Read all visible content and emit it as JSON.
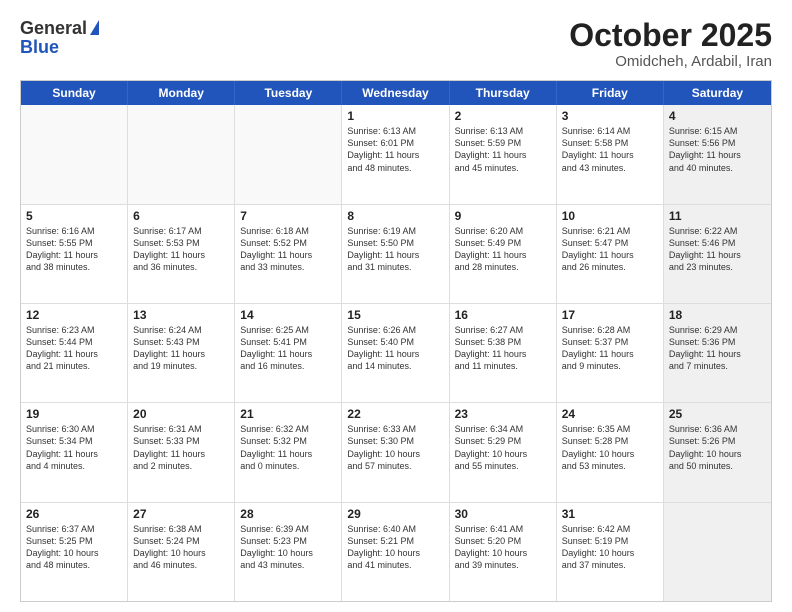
{
  "header": {
    "logo_general": "General",
    "logo_blue": "Blue",
    "month_title": "October 2025",
    "subtitle": "Omidcheh, Ardabil, Iran"
  },
  "weekdays": [
    "Sunday",
    "Monday",
    "Tuesday",
    "Wednesday",
    "Thursday",
    "Friday",
    "Saturday"
  ],
  "rows": [
    [
      {
        "day": "",
        "info": "",
        "empty": true
      },
      {
        "day": "",
        "info": "",
        "empty": true
      },
      {
        "day": "",
        "info": "",
        "empty": true
      },
      {
        "day": "1",
        "info": "Sunrise: 6:13 AM\nSunset: 6:01 PM\nDaylight: 11 hours\nand 48 minutes."
      },
      {
        "day": "2",
        "info": "Sunrise: 6:13 AM\nSunset: 5:59 PM\nDaylight: 11 hours\nand 45 minutes."
      },
      {
        "day": "3",
        "info": "Sunrise: 6:14 AM\nSunset: 5:58 PM\nDaylight: 11 hours\nand 43 minutes."
      },
      {
        "day": "4",
        "info": "Sunrise: 6:15 AM\nSunset: 5:56 PM\nDaylight: 11 hours\nand 40 minutes.",
        "shaded": true
      }
    ],
    [
      {
        "day": "5",
        "info": "Sunrise: 6:16 AM\nSunset: 5:55 PM\nDaylight: 11 hours\nand 38 minutes."
      },
      {
        "day": "6",
        "info": "Sunrise: 6:17 AM\nSunset: 5:53 PM\nDaylight: 11 hours\nand 36 minutes."
      },
      {
        "day": "7",
        "info": "Sunrise: 6:18 AM\nSunset: 5:52 PM\nDaylight: 11 hours\nand 33 minutes."
      },
      {
        "day": "8",
        "info": "Sunrise: 6:19 AM\nSunset: 5:50 PM\nDaylight: 11 hours\nand 31 minutes."
      },
      {
        "day": "9",
        "info": "Sunrise: 6:20 AM\nSunset: 5:49 PM\nDaylight: 11 hours\nand 28 minutes."
      },
      {
        "day": "10",
        "info": "Sunrise: 6:21 AM\nSunset: 5:47 PM\nDaylight: 11 hours\nand 26 minutes."
      },
      {
        "day": "11",
        "info": "Sunrise: 6:22 AM\nSunset: 5:46 PM\nDaylight: 11 hours\nand 23 minutes.",
        "shaded": true
      }
    ],
    [
      {
        "day": "12",
        "info": "Sunrise: 6:23 AM\nSunset: 5:44 PM\nDaylight: 11 hours\nand 21 minutes."
      },
      {
        "day": "13",
        "info": "Sunrise: 6:24 AM\nSunset: 5:43 PM\nDaylight: 11 hours\nand 19 minutes."
      },
      {
        "day": "14",
        "info": "Sunrise: 6:25 AM\nSunset: 5:41 PM\nDaylight: 11 hours\nand 16 minutes."
      },
      {
        "day": "15",
        "info": "Sunrise: 6:26 AM\nSunset: 5:40 PM\nDaylight: 11 hours\nand 14 minutes."
      },
      {
        "day": "16",
        "info": "Sunrise: 6:27 AM\nSunset: 5:38 PM\nDaylight: 11 hours\nand 11 minutes."
      },
      {
        "day": "17",
        "info": "Sunrise: 6:28 AM\nSunset: 5:37 PM\nDaylight: 11 hours\nand 9 minutes."
      },
      {
        "day": "18",
        "info": "Sunrise: 6:29 AM\nSunset: 5:36 PM\nDaylight: 11 hours\nand 7 minutes.",
        "shaded": true
      }
    ],
    [
      {
        "day": "19",
        "info": "Sunrise: 6:30 AM\nSunset: 5:34 PM\nDaylight: 11 hours\nand 4 minutes."
      },
      {
        "day": "20",
        "info": "Sunrise: 6:31 AM\nSunset: 5:33 PM\nDaylight: 11 hours\nand 2 minutes."
      },
      {
        "day": "21",
        "info": "Sunrise: 6:32 AM\nSunset: 5:32 PM\nDaylight: 11 hours\nand 0 minutes."
      },
      {
        "day": "22",
        "info": "Sunrise: 6:33 AM\nSunset: 5:30 PM\nDaylight: 10 hours\nand 57 minutes."
      },
      {
        "day": "23",
        "info": "Sunrise: 6:34 AM\nSunset: 5:29 PM\nDaylight: 10 hours\nand 55 minutes."
      },
      {
        "day": "24",
        "info": "Sunrise: 6:35 AM\nSunset: 5:28 PM\nDaylight: 10 hours\nand 53 minutes."
      },
      {
        "day": "25",
        "info": "Sunrise: 6:36 AM\nSunset: 5:26 PM\nDaylight: 10 hours\nand 50 minutes.",
        "shaded": true
      }
    ],
    [
      {
        "day": "26",
        "info": "Sunrise: 6:37 AM\nSunset: 5:25 PM\nDaylight: 10 hours\nand 48 minutes."
      },
      {
        "day": "27",
        "info": "Sunrise: 6:38 AM\nSunset: 5:24 PM\nDaylight: 10 hours\nand 46 minutes."
      },
      {
        "day": "28",
        "info": "Sunrise: 6:39 AM\nSunset: 5:23 PM\nDaylight: 10 hours\nand 43 minutes."
      },
      {
        "day": "29",
        "info": "Sunrise: 6:40 AM\nSunset: 5:21 PM\nDaylight: 10 hours\nand 41 minutes."
      },
      {
        "day": "30",
        "info": "Sunrise: 6:41 AM\nSunset: 5:20 PM\nDaylight: 10 hours\nand 39 minutes."
      },
      {
        "day": "31",
        "info": "Sunrise: 6:42 AM\nSunset: 5:19 PM\nDaylight: 10 hours\nand 37 minutes."
      },
      {
        "day": "",
        "info": "",
        "empty": true,
        "shaded": true
      }
    ]
  ]
}
